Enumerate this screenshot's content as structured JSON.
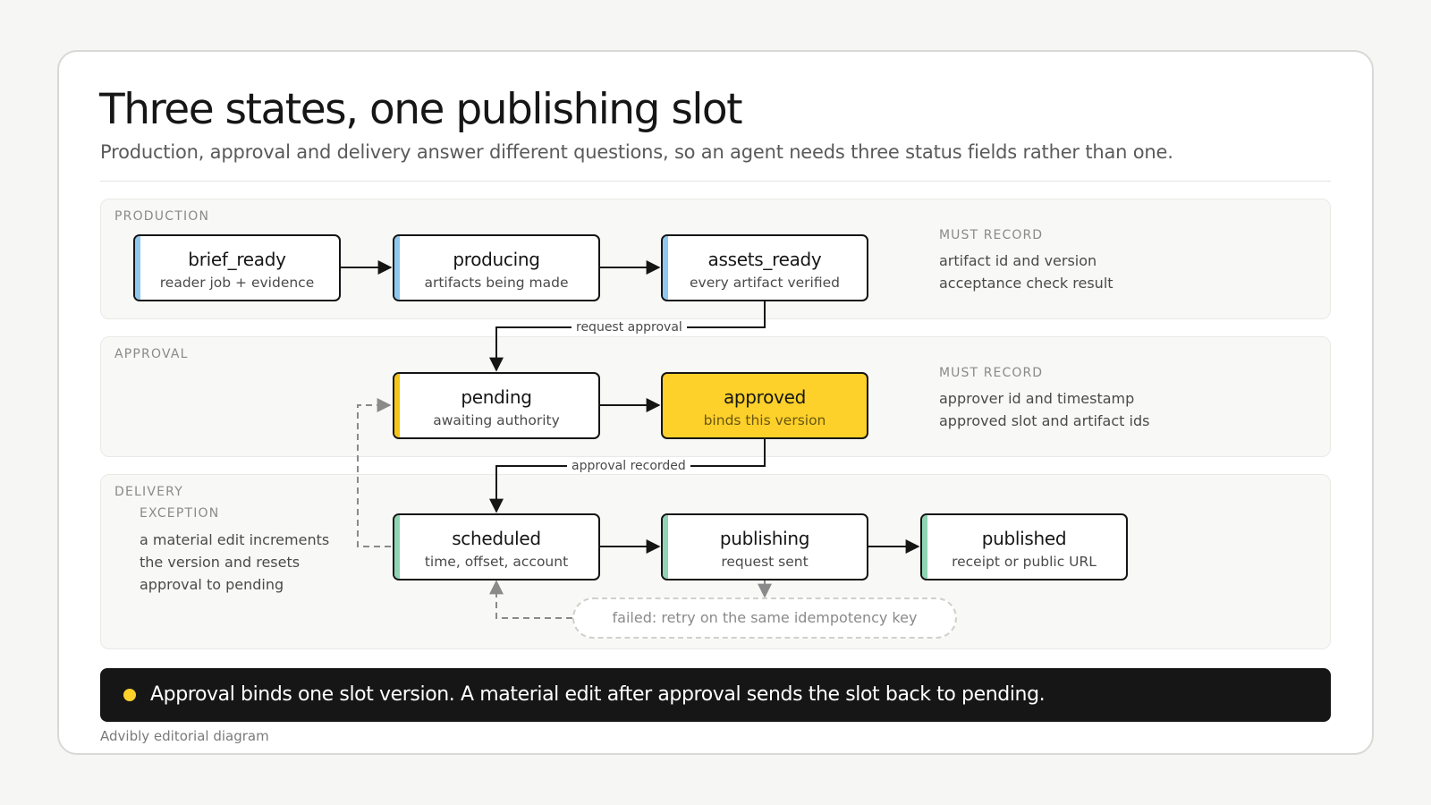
{
  "header": {
    "title": "Three states, one publishing slot",
    "subtitle": "Production, approval and delivery answer different questions, so an agent needs three status fields rather than one."
  },
  "colors": {
    "production_accent": "#8ec8ee",
    "approval_accent": "#f5c518",
    "delivery_accent": "#8fd4b4",
    "highlight_fill": "#fdd12a",
    "callout_bg": "#161616"
  },
  "bands": {
    "production": {
      "label": "PRODUCTION",
      "nodes": [
        {
          "name": "brief_ready",
          "desc": "reader job + evidence"
        },
        {
          "name": "producing",
          "desc": "artifacts being made"
        },
        {
          "name": "assets_ready",
          "desc": "every artifact verified"
        }
      ],
      "must_record": {
        "label": "MUST RECORD",
        "lines": [
          "artifact id and version",
          "acceptance check result"
        ]
      }
    },
    "approval": {
      "label": "APPROVAL",
      "nodes": [
        {
          "name": "pending",
          "desc": "awaiting authority"
        },
        {
          "name": "approved",
          "desc": "binds this version"
        }
      ],
      "must_record": {
        "label": "MUST RECORD",
        "lines": [
          "approver id and timestamp",
          "approved slot and artifact ids"
        ]
      }
    },
    "delivery": {
      "label": "DELIVERY",
      "nodes": [
        {
          "name": "scheduled",
          "desc": "time, offset, account"
        },
        {
          "name": "publishing",
          "desc": "request sent"
        },
        {
          "name": "published",
          "desc": "receipt or public URL"
        }
      ],
      "exception": {
        "label": "EXCEPTION",
        "lines": [
          "a material edit increments",
          "the version and resets",
          "approval to pending"
        ]
      }
    }
  },
  "edges": {
    "request_approval": "request approval",
    "approval_recorded": "approval recorded",
    "retry": "failed: retry on the same idempotency key"
  },
  "callout": "Approval binds one slot version. A material edit after approval sends the slot back to pending.",
  "footer": "Advibly editorial diagram"
}
